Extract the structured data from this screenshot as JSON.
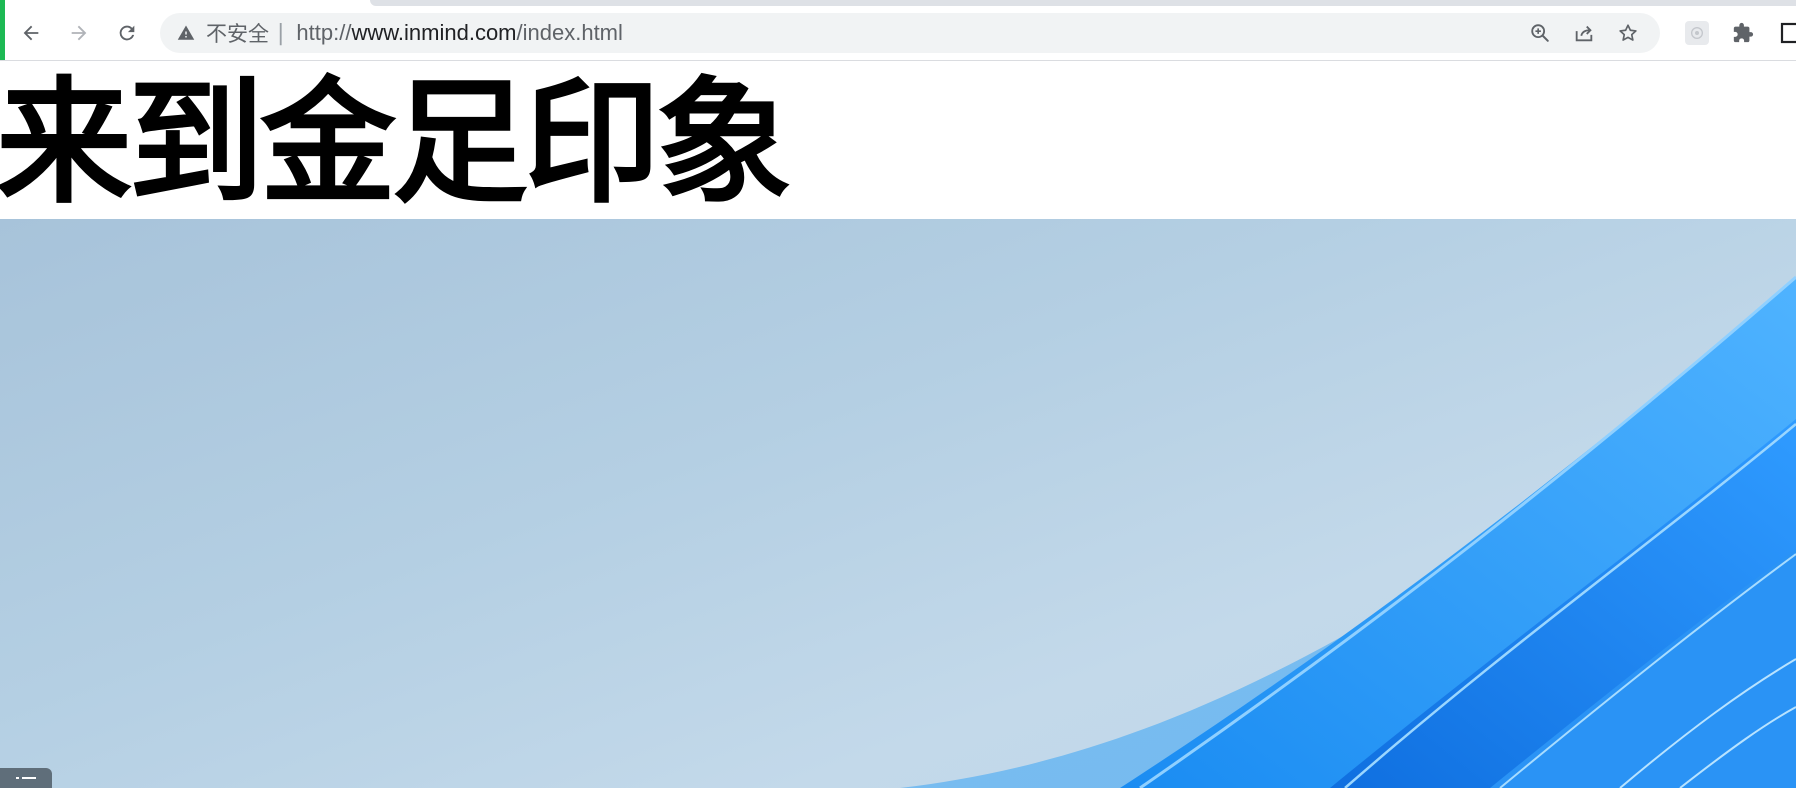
{
  "browser": {
    "security_label": "不安全",
    "separator": "|",
    "url_scheme": "http://",
    "url_host": "www.inmind.com",
    "url_path": "/index.html",
    "icons": {
      "back": "back-arrow-icon",
      "forward": "forward-arrow-icon",
      "reload": "reload-icon",
      "warning": "warning-icon",
      "zoom": "zoom-in-icon",
      "share": "share-icon",
      "bookmark": "star-icon",
      "extension_faded": "extension-faded-icon",
      "extensions": "puzzle-icon",
      "side_panel": "side-panel-icon"
    }
  },
  "page": {
    "heading": "来到金足印象",
    "hero_image_alt": "wallpaper"
  },
  "colors": {
    "accent_bar": "#1db954",
    "omnibox_bg": "#f1f3f4",
    "hero_sky": "#b4cfe3",
    "hero_wave": "#1e90f5"
  }
}
